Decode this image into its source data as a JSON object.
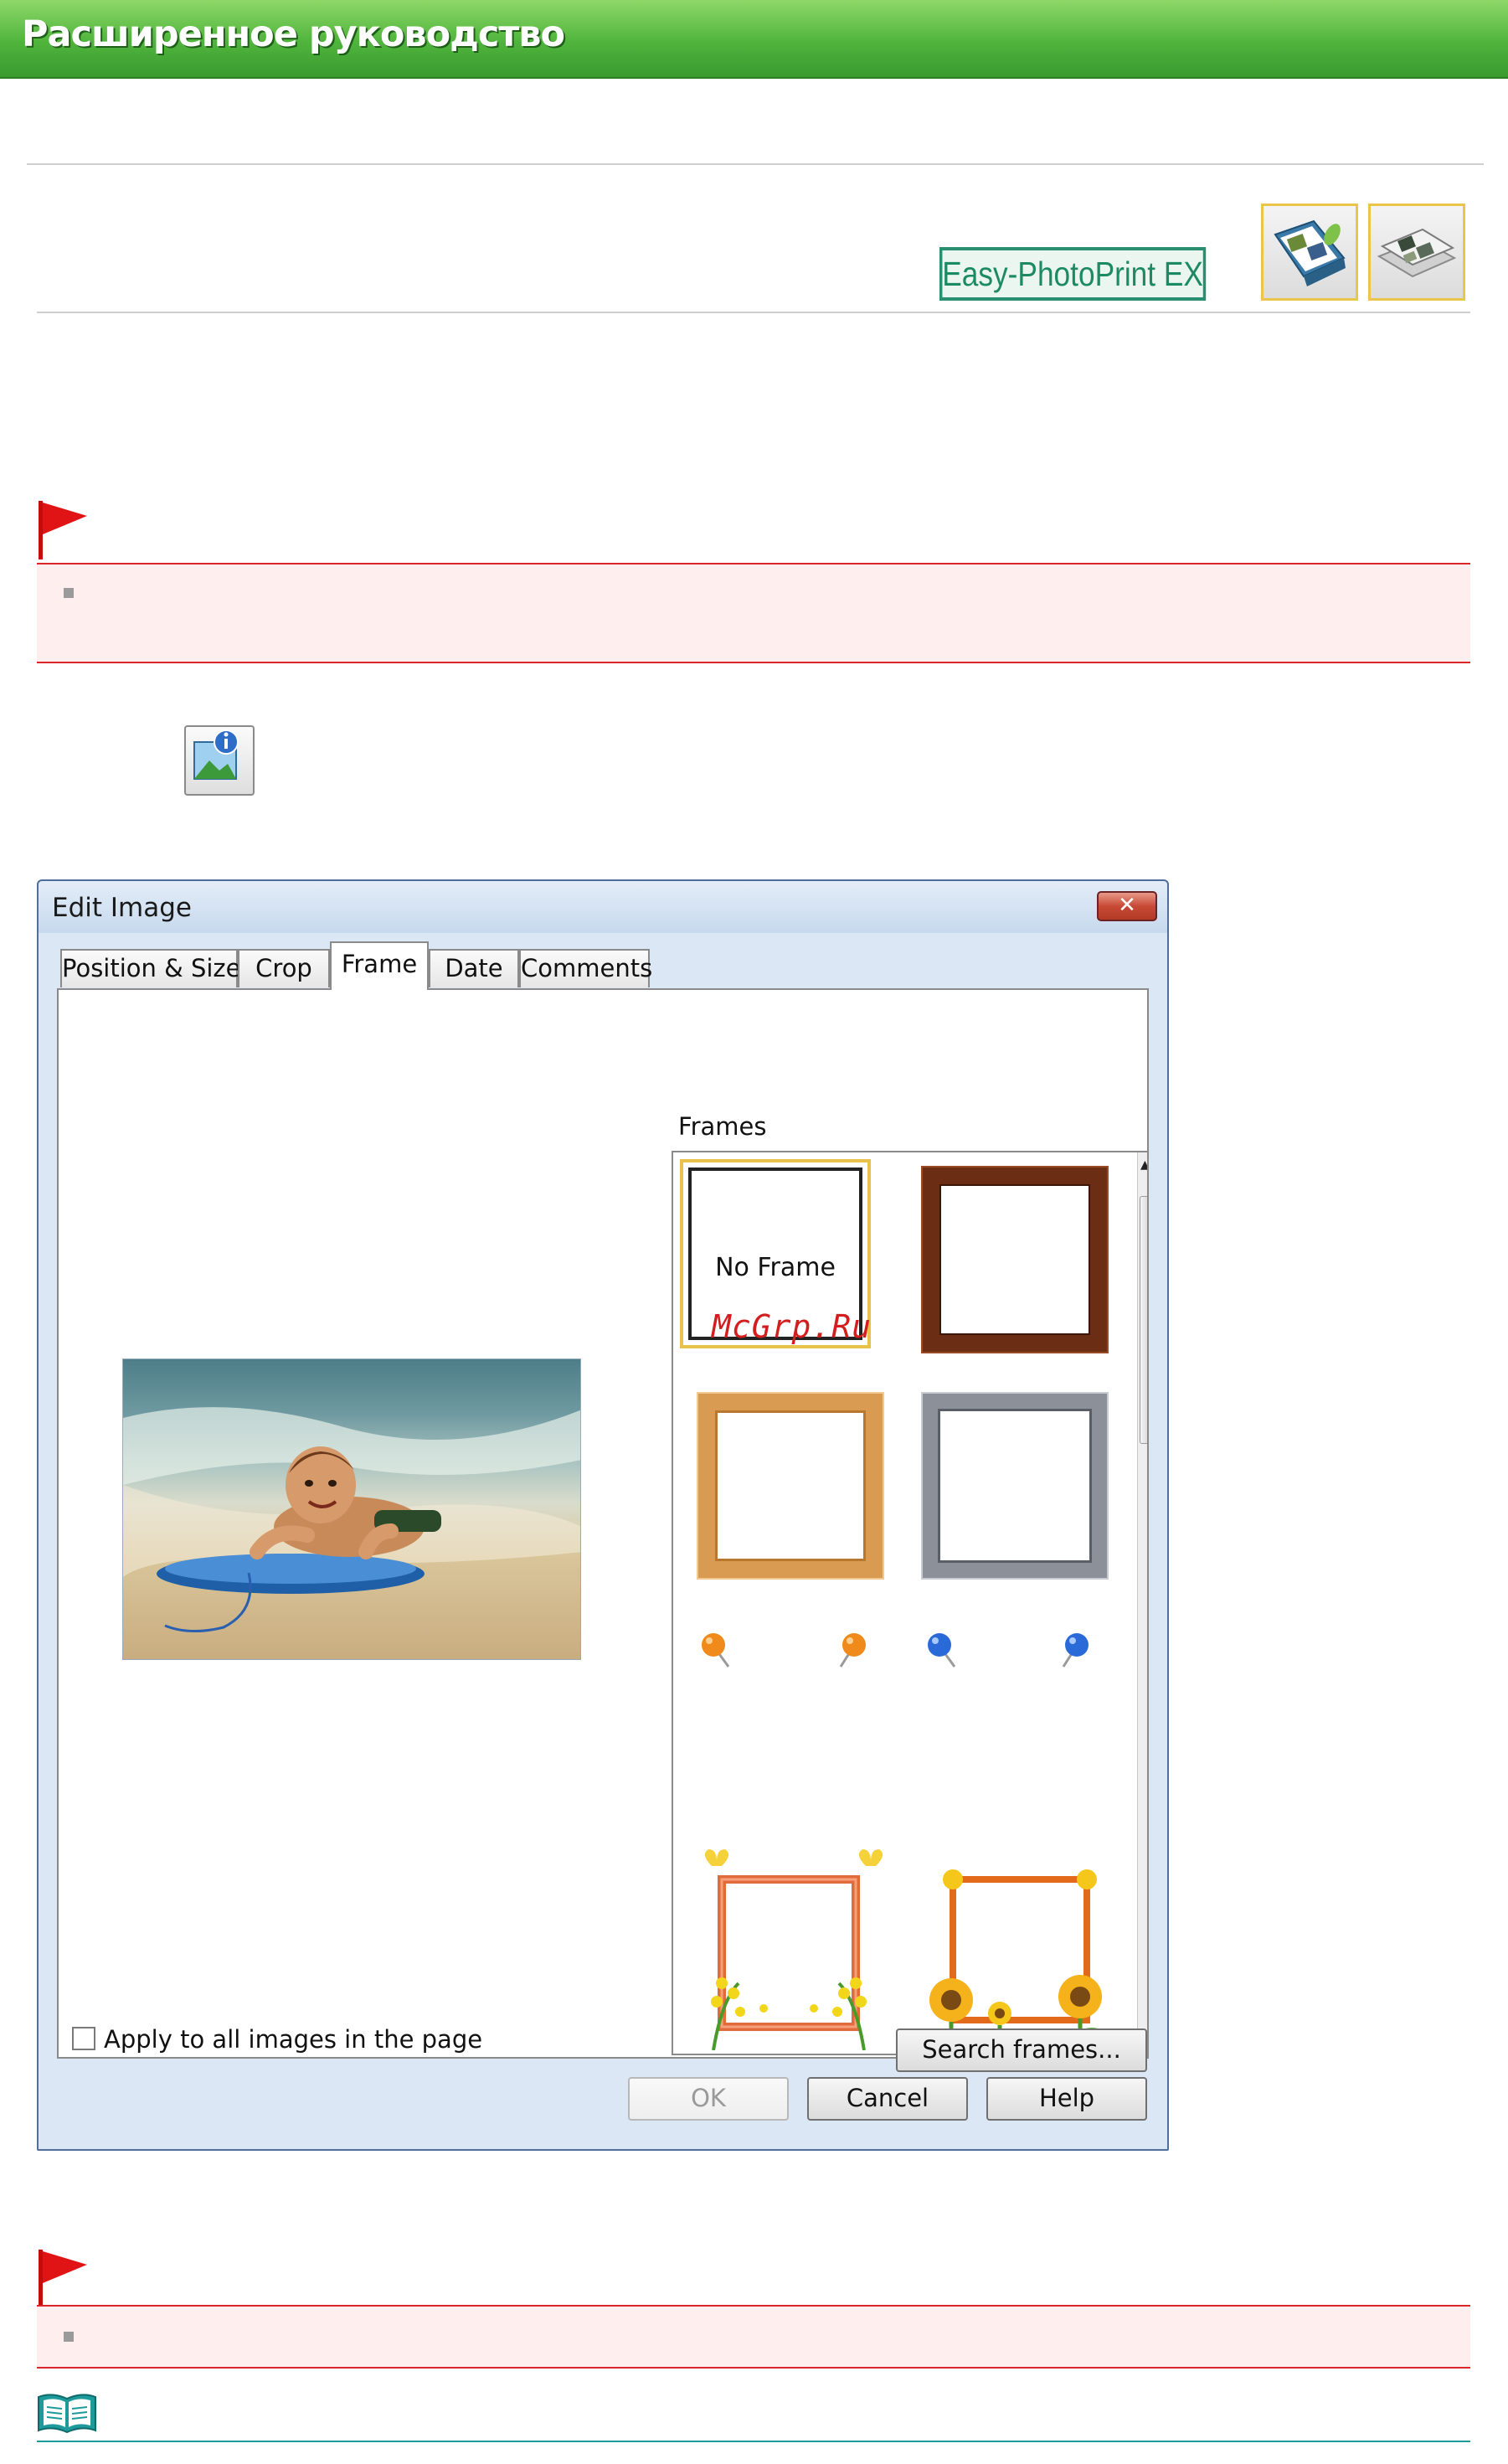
{
  "header": {
    "title": "Расширенное руководство"
  },
  "product": {
    "name": "Easy-PhotoPrint EX",
    "mode_icons": [
      "album-icon",
      "layout-print-icon"
    ]
  },
  "notes": {
    "important_flag_icon": "red-flag-icon",
    "note_icon": "open-book-icon",
    "edit_image_toolbar_icon": "image-info-icon"
  },
  "dialog": {
    "title": "Edit Image",
    "close_label": "✕",
    "tabs": [
      {
        "label": "Position & Size",
        "active": false
      },
      {
        "label": "Crop",
        "active": false
      },
      {
        "label": "Frame",
        "active": true
      },
      {
        "label": "Date",
        "active": false
      },
      {
        "label": "Comments",
        "active": false
      }
    ],
    "frames_label": "Frames",
    "frames": [
      {
        "label": "No Frame",
        "selected": true
      },
      {
        "name": "wood-dark-frame"
      },
      {
        "name": "wood-light-frame"
      },
      {
        "name": "silver-frame"
      },
      {
        "name": "pushpin-orange-frame"
      },
      {
        "name": "pushpin-blue-frame"
      },
      {
        "name": "butterfly-flowers-frame"
      },
      {
        "name": "sunflower-frame"
      }
    ],
    "watermark": "McGrp.Ru",
    "apply_all_label": "Apply to all images in the page",
    "apply_all_checked": false,
    "search_frames_label": "Search frames...",
    "ok_label": "OK",
    "cancel_label": "Cancel",
    "help_label": "Help"
  },
  "colors": {
    "header_green": "#4fb43c",
    "note_border_red": "#d8262b",
    "note_bg": "#ffeeee",
    "brand_teal": "#1d8a66",
    "selection_gold": "#e8c24a"
  }
}
